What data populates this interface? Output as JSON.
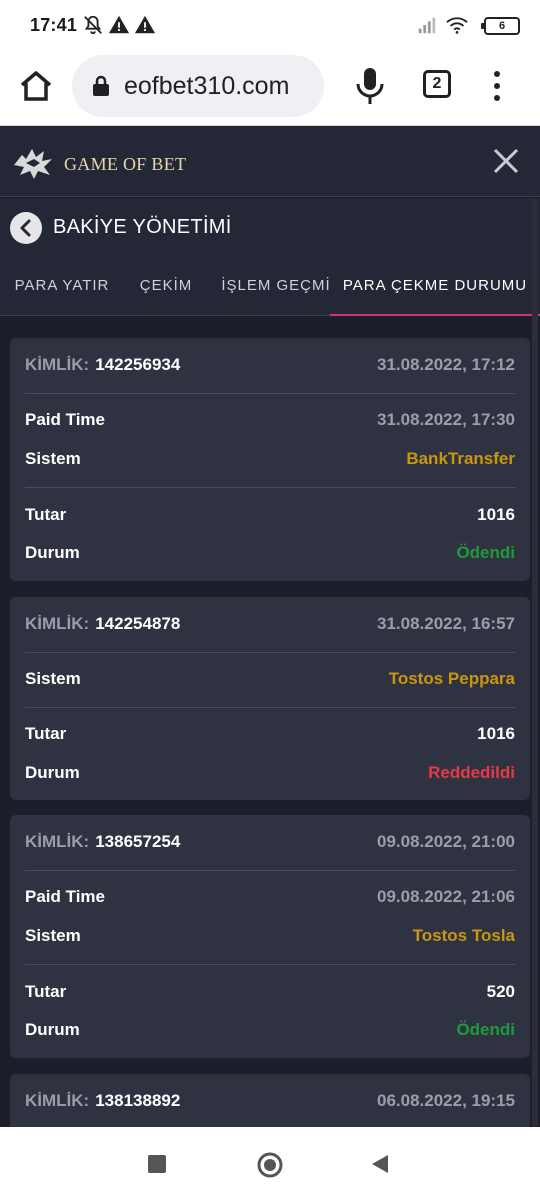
{
  "status_bar": {
    "time": "17:41",
    "battery": "6",
    "icons": [
      "bell-off-icon",
      "warning-icon",
      "warning-icon",
      "signal-icon",
      "wifi-icon",
      "battery-icon"
    ]
  },
  "browser": {
    "url": "eofbet310.com",
    "tab_count": "2",
    "icons": [
      "home-icon",
      "lock-icon",
      "mic-icon",
      "tabs-icon",
      "menu-icon"
    ]
  },
  "app": {
    "logo_text": "GAME OF BET",
    "close_icon": "close-icon"
  },
  "page": {
    "title": "BAKİYE YÖNETİMİ",
    "back_icon": "chevron-left-icon"
  },
  "tabs": [
    {
      "label": "PARA YATIR",
      "active": false
    },
    {
      "label": "ÇEKİM",
      "active": false
    },
    {
      "label": "İŞLEM GEÇMİ",
      "active": false
    },
    {
      "label": "PARA ÇEKME DURUMU",
      "active": true
    }
  ],
  "colors": {
    "accent": "#d6307a",
    "system_value": "#c8960f",
    "status_paid": "#1f9a3a",
    "status_rejected": "#e63946",
    "card_bg": "#2f3341",
    "page_bg": "#1c1f2a"
  },
  "labels": {
    "id": "KİMLİK:",
    "paid_time": "Paid Time",
    "system": "Sistem",
    "amount": "Tutar",
    "status": "Durum"
  },
  "withdrawals": [
    {
      "id": "142256934",
      "date": "31.08.2022, 17:12",
      "paid_time": "31.08.2022, 17:30",
      "system": "BankTransfer",
      "amount": "1016",
      "status": "Ödendi"
    },
    {
      "id": "142254878",
      "date": "31.08.2022, 16:57",
      "system": "Tostos Peppara",
      "amount": "1016",
      "status": "Reddedildi"
    },
    {
      "id": "138657254",
      "date": "09.08.2022, 21:00",
      "paid_time": "09.08.2022, 21:06",
      "system": "Tostos Tosla",
      "amount": "520",
      "status": "Ödendi"
    },
    {
      "id": "138138892",
      "date": "06.08.2022, 19:15"
    }
  ],
  "nav_bar": {
    "icons": [
      "recent-apps-icon",
      "home-circle-icon",
      "back-triangle-icon"
    ]
  }
}
